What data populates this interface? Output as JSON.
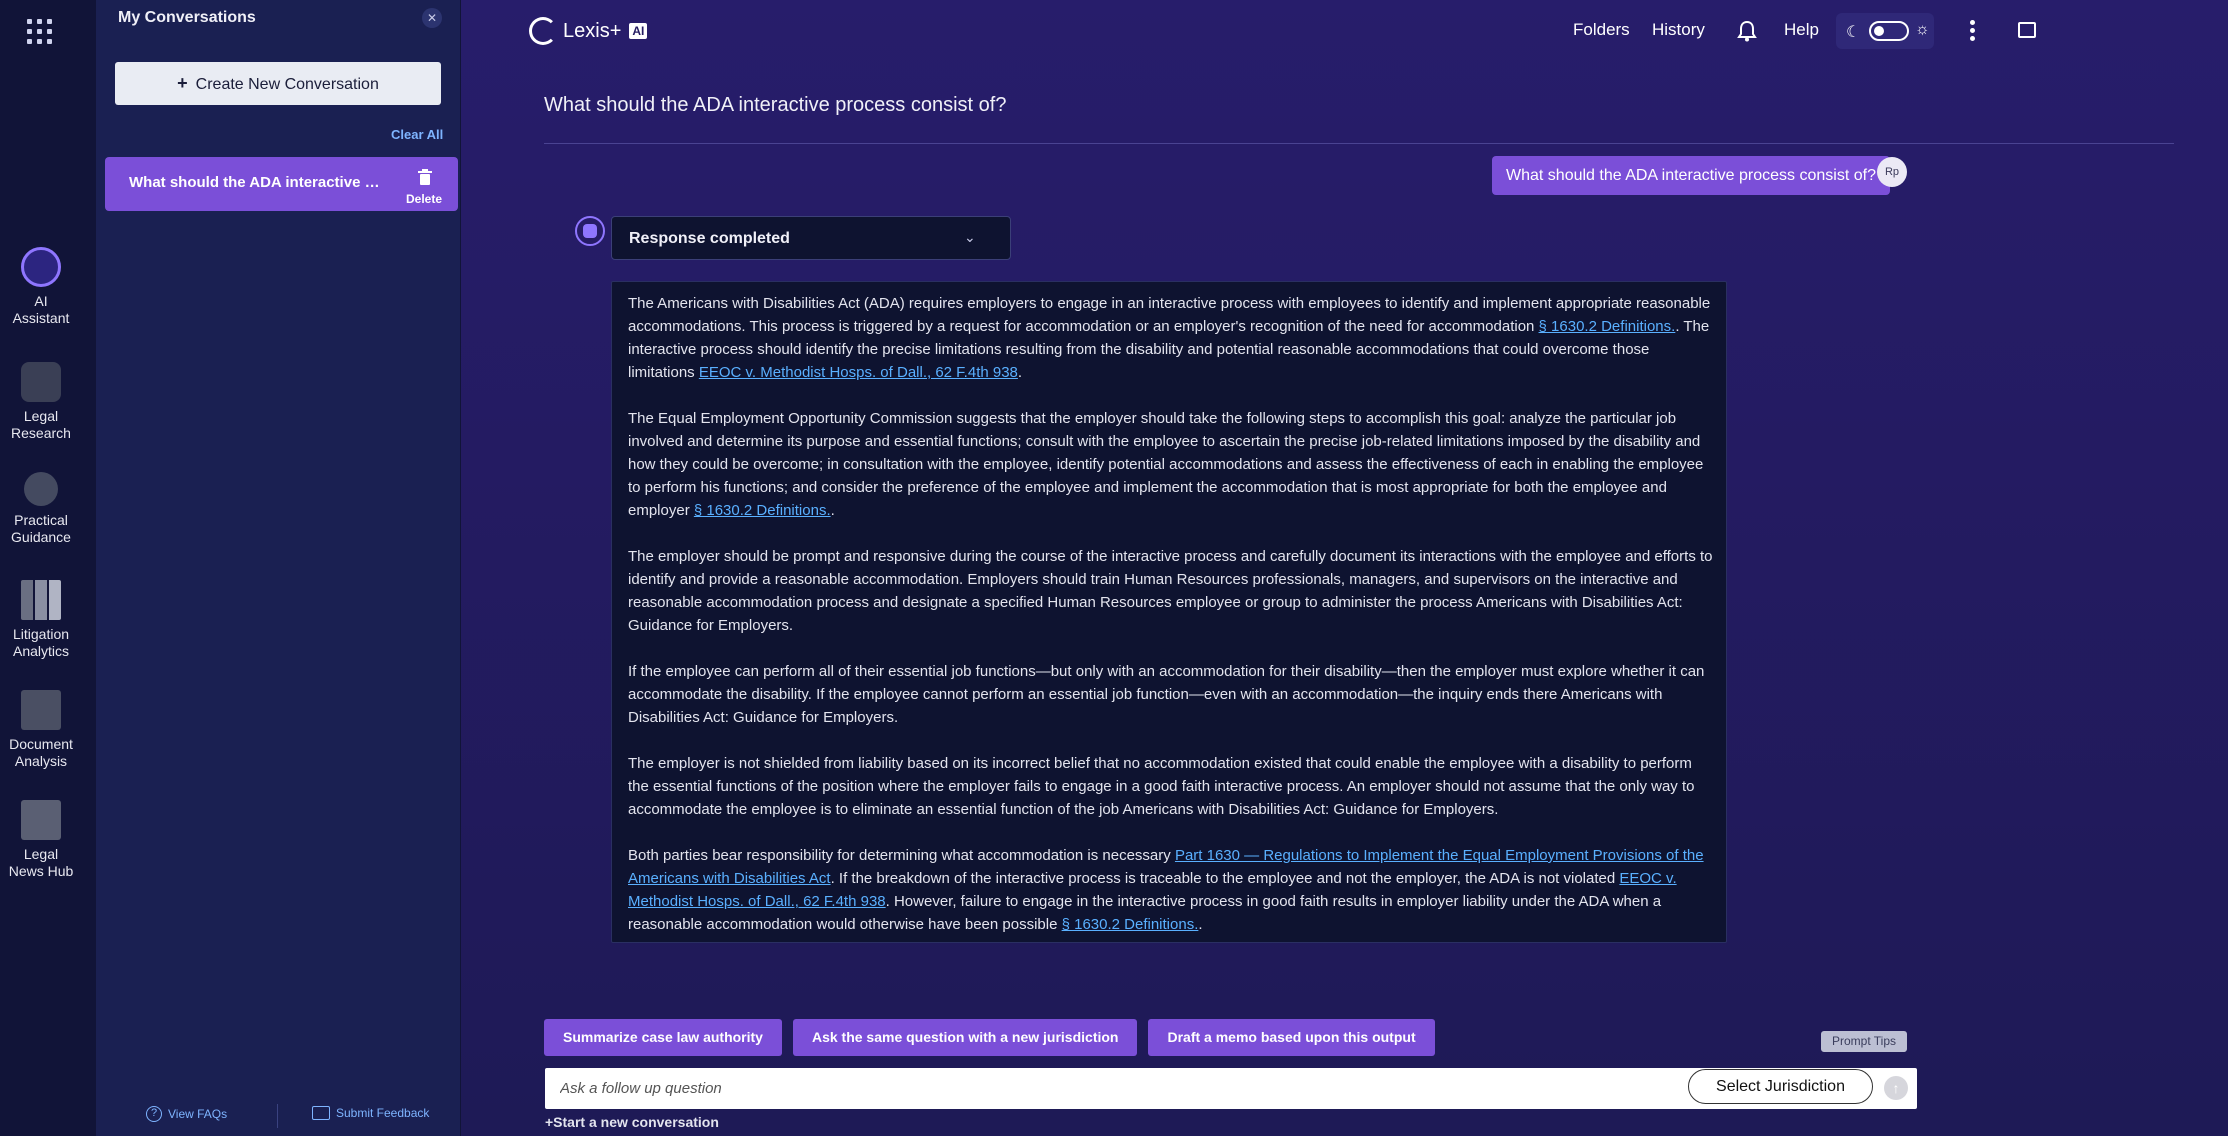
{
  "rail": {
    "items": [
      {
        "label": "AI\nAssistant",
        "icon": "ai-assistant-icon"
      },
      {
        "label": "Legal\nResearch",
        "icon": "legal-research-icon"
      },
      {
        "label": "Practical\nGuidance",
        "icon": "practical-guidance-icon"
      },
      {
        "label": "Litigation\nAnalytics",
        "icon": "litigation-analytics-icon"
      },
      {
        "label": "Document\nAnalysis",
        "icon": "document-analysis-icon"
      },
      {
        "label": "Legal\nNews Hub",
        "icon": "legal-news-hub-icon"
      }
    ]
  },
  "panel": {
    "title": "My Conversations",
    "create_label": "Create New Conversation",
    "clear_all": "Clear All",
    "conversations": [
      {
        "title": "What should the ADA interactive process consist of?",
        "delete_label": "Delete"
      }
    ],
    "footer": {
      "faqs": "View FAQs",
      "feedback": "Submit Feedback"
    }
  },
  "topbar": {
    "brand": "Lexis+",
    "brand_badge": "AI",
    "nav": [
      "Folders",
      "History",
      "Help"
    ]
  },
  "conversation": {
    "title": "What should the ADA interactive process consist of?",
    "user_message": "What should the ADA interactive process consist of?",
    "user_initials": "Rp",
    "status": "Response completed"
  },
  "response": {
    "p1_t1": "The Americans with Disabilities Act (ADA) requires employers to engage in an interactive process with employees to identify and implement appropriate reasonable accommodations. This process is triggered by a request for accommodation or an employer's recognition of the need for accommodation ",
    "p1_l1": "§ 1630.2 Definitions.",
    "p1_t2": ". The interactive process should identify the precise limitations resulting from the disability and potential reasonable accommodations that could overcome those limitations ",
    "p1_l2": "EEOC v. Methodist Hosps. of Dall., 62 F.4th 938",
    "p1_t3": ".",
    "p2_t1": "The Equal Employment Opportunity Commission suggests that the employer should take the following steps to accomplish this goal: analyze the particular job involved and determine its purpose and essential functions; consult with the employee to ascertain the precise job-related limitations imposed by the disability and how they could be overcome; in consultation with the employee, identify potential accommodations and assess the effectiveness of each in enabling the employee to perform his functions; and consider the preference of the employee and implement the accommodation that is most appropriate for both the employee and employer ",
    "p2_l1": "§ 1630.2 Definitions.",
    "p2_t2": ".",
    "p3": "The employer should be prompt and responsive during the course of the interactive process and carefully document its interactions with the employee and efforts to identify and provide a reasonable accommodation. Employers should train Human Resources professionals, managers, and supervisors on the interactive and reasonable accommodation process and designate a specified Human Resources employee or group to administer the process  Americans with Disabilities Act: Guidance for Employers.",
    "p4": "If the employee can perform all of their essential job functions—but only with an accommodation for their disability—then the employer must explore whether it can accommodate the disability. If the employee cannot perform an essential job function—even with an accommodation—the inquiry ends there  Americans with Disabilities Act: Guidance for Employers.",
    "p5": "The employer is not shielded from liability based on its incorrect belief that no accommodation existed that could enable the employee with a disability to perform the essential functions of the position where the employer fails to engage in a good faith interactive process. An employer should not assume that the only way to accommodate the employee is to eliminate an essential function of the job  Americans with Disabilities Act: Guidance for Employers.",
    "p6_t1": "Both parties bear responsibility for determining what accommodation is necessary ",
    "p6_l1": "Part 1630 — Regulations to Implement the Equal Employment Provisions of the Americans with Disabilities Act",
    "p6_t2": ". If the breakdown of the interactive process is traceable to the employee and not the employer, the ADA is not violated ",
    "p6_l2": "EEOC v. Methodist Hosps. of Dall., 62 F.4th 938",
    "p6_t3": ". However, failure to engage in the interactive process in good faith results in employer liability under the ADA when a reasonable accommodation would otherwise have been possible ",
    "p6_l3": "§ 1630.2 Definitions.",
    "p6_t4": "."
  },
  "chips": [
    "Summarize case law authority",
    "Ask the same question with a new jurisdiction",
    "Draft a memo based upon this output"
  ],
  "prompt_tips": "Prompt Tips",
  "ask": {
    "placeholder": "Ask a follow up question",
    "jurisdiction": "Select Jurisdiction"
  },
  "start_new": "+Start a new conversation",
  "colors": {
    "accent": "#7b4fd8",
    "link": "#5ab0ff",
    "panel": "#1a2052",
    "rail": "#111438"
  }
}
